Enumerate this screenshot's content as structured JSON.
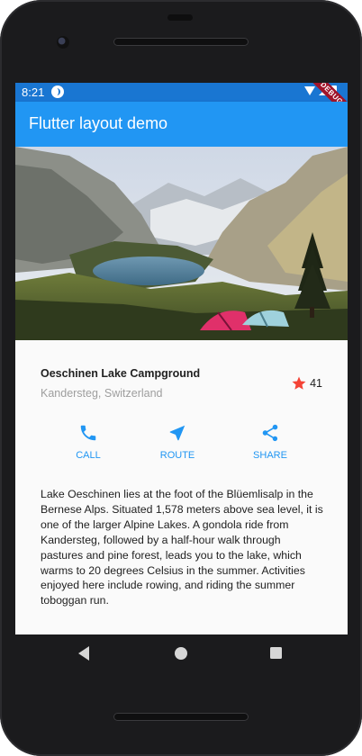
{
  "status_bar": {
    "time": "8:21",
    "debug_label": "DEBUG"
  },
  "app_bar": {
    "title": "Flutter layout demo"
  },
  "place": {
    "title": "Oeschinen Lake Campground",
    "subtitle": "Kandersteg, Switzerland",
    "rating_count": "41",
    "star_color": "#f44336"
  },
  "actions": [
    {
      "label": "CALL",
      "icon": "phone-icon"
    },
    {
      "label": "ROUTE",
      "icon": "near-me-icon"
    },
    {
      "label": "SHARE",
      "icon": "share-icon"
    }
  ],
  "description": "Lake Oeschinen lies at the foot of the Blüemlisalp in the Bernese Alps. Situated 1,578 meters above sea level, it is one of the larger Alpine Lakes. A gondola ride from Kandersteg, followed by a half-hour walk through pastures and pine forest, leads you to the lake, which warms to 20 degrees Celsius in the summer. Activities enjoyed here include rowing, and riding the summer toboggan run.",
  "colors": {
    "primary": "#2196f3",
    "status_bar": "#1976d2"
  }
}
